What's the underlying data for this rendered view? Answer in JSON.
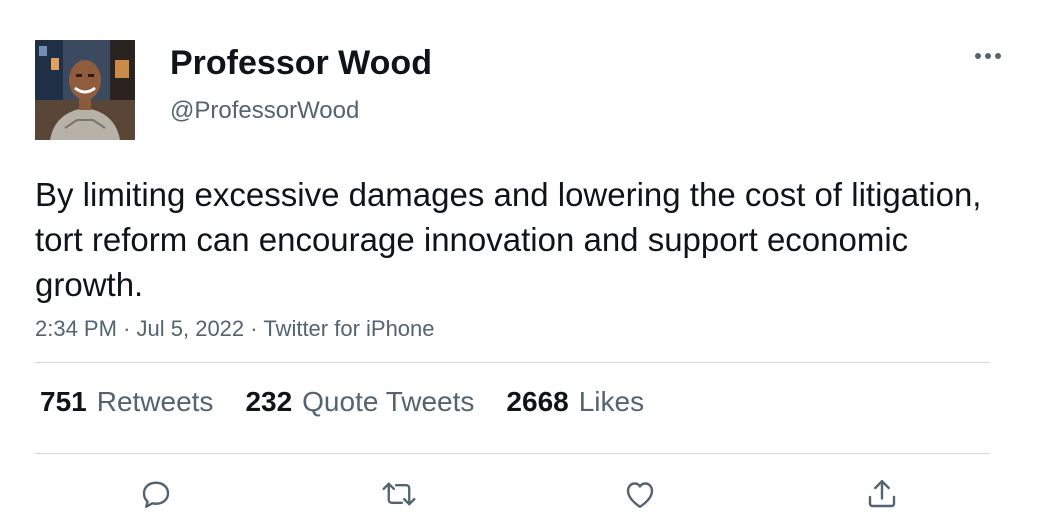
{
  "author": {
    "display_name": "Professor Wood",
    "handle": "@ProfessorWood"
  },
  "tweet": {
    "text": "By limiting excessive damages and lowering the cost of litigation, tort reform can encourage innovation and support economic growth.",
    "time": "2:34 PM",
    "date": "Jul 5, 2022",
    "source": "Twitter for iPhone",
    "separator": "·"
  },
  "stats": {
    "retweets_count": "751",
    "retweets_label": "Retweets",
    "quotes_count": "232",
    "quotes_label": "Quote Tweets",
    "likes_count": "2668",
    "likes_label": "Likes"
  },
  "icons": {
    "more": "more-horizontal-icon",
    "reply": "reply-icon",
    "retweet": "retweet-icon",
    "like": "heart-icon",
    "share": "share-icon"
  },
  "colors": {
    "text_primary": "#0f1419",
    "text_secondary": "#536471",
    "divider": "#cfd9de"
  }
}
